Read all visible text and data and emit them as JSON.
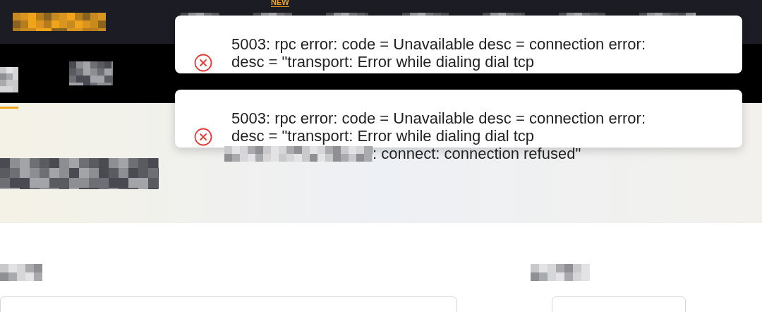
{
  "top_bar": {
    "new_badge": "NEW"
  },
  "toasts": [
    {
      "kind": "error",
      "lines": [
        "5003: rpc error: code = Unavailable desc = connection error:",
        "desc = \"transport: Error while dialing dial tcp"
      ]
    },
    {
      "kind": "error",
      "lines": [
        "5003: rpc error: code = Unavailable desc = connection error:",
        "desc = \"transport: Error while dialing dial tcp"
      ],
      "overflow_line": ": connect: connection refused\""
    }
  ]
}
